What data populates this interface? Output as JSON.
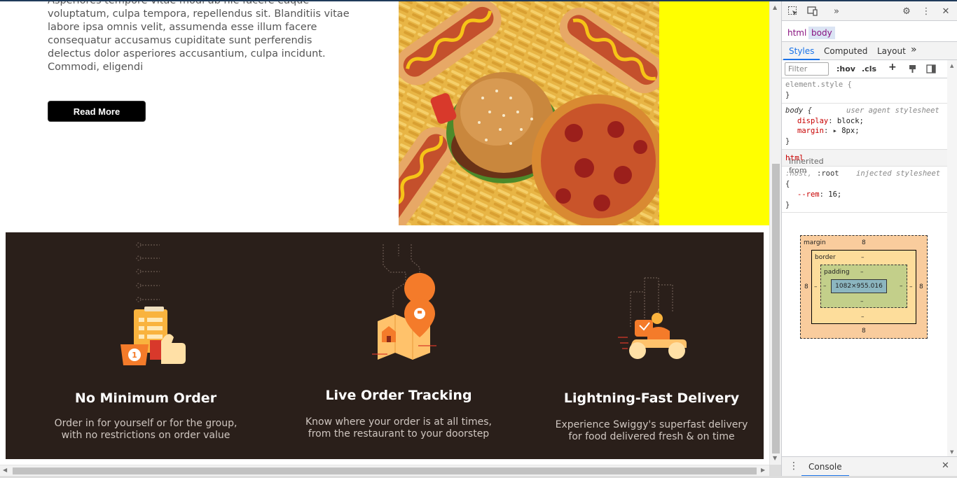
{
  "page": {
    "about_text": "Asperiores tempore vitae modi ab nie facere eaque voluptatum, culpa tempora, repellendus sit. Blanditiis vitae labore ipsa omnis velit, assumenda esse illum facere consequatur accusamus cupiditate sunt perferendis delectus dolor asperiores accusantium, culpa incidunt. Commodi, eligendi",
    "read_more_label": "Read More",
    "features": [
      {
        "icon": "order-checklist-thumbs-up-icon",
        "title": "No Minimum Order",
        "desc_line1": "Order in for yourself or for the group,",
        "desc_line2": "with no restrictions on order value"
      },
      {
        "icon": "map-location-pin-icon",
        "title": "Live Order Tracking",
        "desc_line1": "Know where your order is at all times,",
        "desc_line2": "from the restaurant to your doorstep"
      },
      {
        "icon": "delivery-scooter-icon",
        "title": "Lightning-Fast Delivery",
        "desc_line1": "Experience Swiggy's superfast delivery",
        "desc_line2": "for food delivered fresh & on time"
      }
    ],
    "colors": {
      "features_bg": "#2a1f1a",
      "accent_orange": "#f47b2a",
      "yellow_block": "#ffff00",
      "button_bg": "#000000"
    }
  },
  "devtools": {
    "crumbs": [
      "html",
      "body"
    ],
    "tabs": [
      "Styles",
      "Computed",
      "Layout"
    ],
    "active_tab": "Styles",
    "filter_placeholder": "Filter",
    "hov_label": ":hov",
    "cls_label": ".cls",
    "element_style": "element.style {",
    "close_brace": "}",
    "body_rule": {
      "selector": "body {",
      "source": "user agent stylesheet",
      "display_prop": "display",
      "display_val": "block;",
      "margin_prop": "margin",
      "margin_val": "8px;"
    },
    "inherited_label": "Inherited from",
    "inherited_tag": "html",
    "root_rule": {
      "selector_host": ":host,",
      "selector_root": ":root",
      "source": "injected stylesheet",
      "open_brace": "{",
      "prop": "--rem",
      "val": "16;"
    },
    "box_model": {
      "margin_label": "margin",
      "border_label": "border",
      "padding_label": "padding",
      "margin_top": "8",
      "margin_bottom": "8",
      "margin_left": "8",
      "margin_right": "8",
      "border_value": "–",
      "padding_value": "–",
      "content_size": "1082×955.016"
    },
    "drawer_tab": "Console"
  }
}
